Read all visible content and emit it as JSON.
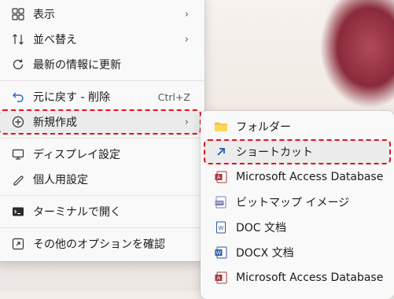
{
  "context_menu": {
    "items": [
      {
        "label": "表示",
        "icon": "view-icon",
        "submenu": true
      },
      {
        "label": "並べ替え",
        "icon": "sort-icon",
        "submenu": true
      },
      {
        "label": "最新の情報に更新",
        "icon": "refresh-icon"
      },
      {
        "label": "元に戻す - 削除",
        "icon": "undo-icon",
        "shortcut": "Ctrl+Z"
      },
      {
        "label": "新規作成",
        "icon": "new-icon",
        "submenu": true,
        "highlighted": true
      },
      {
        "label": "ディスプレイ設定",
        "icon": "display-icon"
      },
      {
        "label": "個人用設定",
        "icon": "personalize-icon"
      },
      {
        "label": "ターミナルで開く",
        "icon": "terminal-icon"
      },
      {
        "label": "その他のオプションを確認",
        "icon": "more-options-icon"
      }
    ]
  },
  "new_submenu": {
    "items": [
      {
        "label": "フォルダー",
        "icon": "folder-icon"
      },
      {
        "label": "ショートカット",
        "icon": "shortcut-icon",
        "highlighted": true
      },
      {
        "label": "Microsoft Access Database",
        "icon": "access-icon"
      },
      {
        "label": "ビットマップ イメージ",
        "icon": "bitmap-icon"
      },
      {
        "label": "DOC 文档",
        "icon": "doc-icon"
      },
      {
        "label": "DOCX 文档",
        "icon": "docx-icon"
      },
      {
        "label": "Microsoft Access Database",
        "icon": "access-icon"
      }
    ]
  },
  "colors": {
    "highlight_border": "#e2141f",
    "menu_bg": "#f9f9f9"
  }
}
